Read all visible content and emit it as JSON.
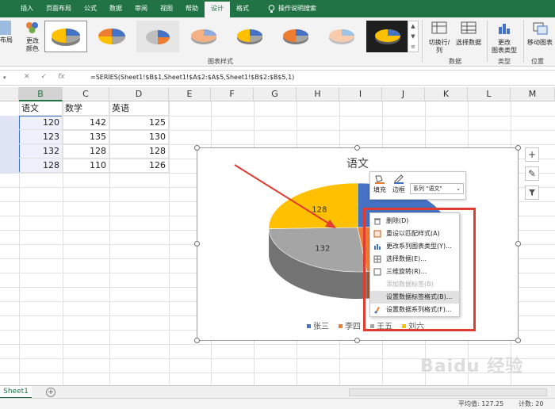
{
  "ribbon_tabs": [
    "插入",
    "页面布局",
    "公式",
    "数据",
    "审阅",
    "视图",
    "帮助",
    "设计",
    "格式"
  ],
  "active_tab": "设计",
  "tell_me": "操作说明搜索",
  "ribbon": {
    "left_label_1": "布局",
    "change_colors_1": "更改",
    "change_colors_2": "颜色",
    "chart_styles_label": "图表样式",
    "switch_row_col": "切换行/列",
    "select_data": "选择数据",
    "data_group": "数据",
    "change_type_1": "更改",
    "change_type_2": "图表类型",
    "type_group": "类型",
    "move_chart": "移动图表",
    "location_group": "位置"
  },
  "formula_bar": {
    "fx": "fx",
    "formula": "=SERIES(Sheet1!$B$1,Sheet1!$A$2:$A$5,Sheet1!$B$2:$B$5,1)"
  },
  "columns": [
    "B",
    "C",
    "D",
    "E",
    "F",
    "G",
    "H",
    "I",
    "J",
    "K",
    "L",
    "M"
  ],
  "table": {
    "headers": [
      "语文",
      "数学",
      "英语"
    ],
    "rows": [
      [
        "120",
        "142",
        "125"
      ],
      [
        "123",
        "135",
        "130"
      ],
      [
        "132",
        "128",
        "128"
      ],
      [
        "128",
        "110",
        "126"
      ]
    ]
  },
  "chart_data": {
    "type": "pie",
    "title": "语文",
    "categories": [
      "张三",
      "李四",
      "王五",
      "刘六"
    ],
    "values": [
      120,
      123,
      132,
      128
    ],
    "visible_labels": {
      "2": "132",
      "3": "128"
    },
    "colors": [
      "#4472c4",
      "#ed7d31",
      "#a5a5a5",
      "#ffc000"
    ],
    "legend_position": "bottom"
  },
  "mini_toolbar": {
    "fill_label": "填充",
    "border_label": "边框",
    "series_select": "系列 \"语文\""
  },
  "context_menu": [
    {
      "label": "删除(D)",
      "enabled": true,
      "icon": "delete-icon"
    },
    {
      "label": "重设以匹配样式(A)",
      "enabled": true,
      "icon": "reset-icon"
    },
    {
      "label": "更改系列图表类型(Y)...",
      "enabled": true,
      "icon": "chart-type-icon"
    },
    {
      "label": "选择数据(E)...",
      "enabled": true,
      "icon": "select-data-icon"
    },
    {
      "label": "三维旋转(R)...",
      "enabled": true,
      "icon": "rotate-3d-icon"
    },
    {
      "label": "添加数据标签(B)",
      "enabled": false,
      "icon": ""
    },
    {
      "label": "设置数据标签格式(B)...",
      "enabled": true,
      "icon": "",
      "highlighted": true
    },
    {
      "label": "设置数据系列格式(F)...",
      "enabled": true,
      "icon": "format-series-icon"
    }
  ],
  "sheet_tab": "Sheet1",
  "status": {
    "average": "平均值: 127.25",
    "count": "计数: 20"
  },
  "watermark": "Baidu 经验",
  "colors": {
    "excel_green": "#217346",
    "annotation_red": "#e03c31"
  }
}
